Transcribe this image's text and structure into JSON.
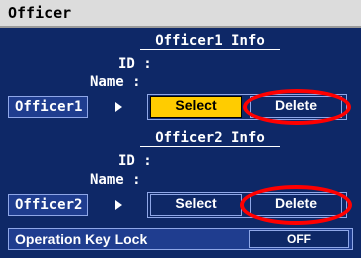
{
  "window": {
    "title": "Officer"
  },
  "officer1": {
    "header": "Officer1 Info",
    "id_label": "ID :",
    "name_label": "Name :",
    "button_label": "Officer1",
    "select_label": "Select",
    "delete_label": "Delete"
  },
  "officer2": {
    "header": "Officer2 Info",
    "id_label": "ID :",
    "name_label": "Name :",
    "button_label": "Officer2",
    "select_label": "Select",
    "delete_label": "Delete"
  },
  "lock": {
    "label": "Operation Key Lock",
    "value": "OFF"
  },
  "colors": {
    "background": "#0e2867",
    "selected": "#ffcc00",
    "annotation": "#ff0000"
  },
  "icons": {
    "arrow": "triangle-right-icon"
  }
}
